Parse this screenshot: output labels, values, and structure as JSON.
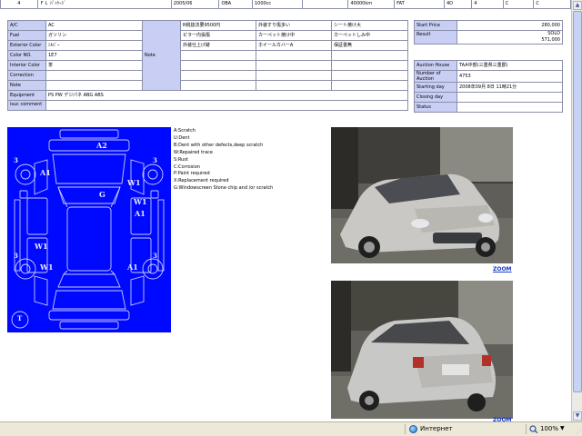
{
  "top_row": [
    "4",
    "ＦＬ ﾊﾟｯｹｰｼﾞ",
    "2005/06",
    "OBA",
    "1000cc",
    "40000km",
    "FAT",
    "4D",
    "4",
    "C",
    "C"
  ],
  "specs": {
    "ac_label": "A/C",
    "ac_value": "AC",
    "fuel_label": "Fuel",
    "fuel_value": "ガソリン",
    "color_label": "Exterior Color",
    "color_value": "ｼﾙﾊﾞｰ",
    "colorno_label": "Color NO.",
    "colorno_value": "1E7",
    "interior_label": "Interior Color",
    "interior_value": "茶",
    "correction_label": "Correction",
    "note_label": "Note",
    "equipment_label": "Equipment",
    "equipment_value": "PS PW デジパネ ABG ABS",
    "isuc_label": "isuc comment",
    "note_col_label": "Note"
  },
  "notes": [
    [
      "R税抜法要9500円",
      "外装すり傷多い",
      "シート焼け大"
    ],
    [
      "ピラー内張傷",
      "カーペット焼け中",
      "カーペットしみ中"
    ],
    [
      "外装仕上げ跡",
      "ホイールカバーA",
      "保証書無"
    ]
  ],
  "price": {
    "start_label": "Start Price",
    "start_value": "280,000",
    "result_label": "Result",
    "result_status": "SOLD",
    "result_value": "571,000"
  },
  "auction": {
    "house_label": "Auction House",
    "house_value": "TAA中部(三重県三重郡)",
    "number_label": "Number of Auction",
    "number_value": "4753",
    "starting_label": "Starting day",
    "starting_value": "2008年09月 8日 11時21分",
    "closing_label": "Closing day",
    "status_label": "Status"
  },
  "diagram_marks": {
    "a2": "A2",
    "three_l": "3",
    "three_r": "3",
    "a1_l": "A1",
    "w1_r": "W1",
    "g": "G",
    "w1_r2": "W1",
    "a1_r": "A1",
    "w1_l": "W1",
    "a1_bl": "A1",
    "a1_br": "A1",
    "w1_bl": "W1",
    "three_bl": "3",
    "three_br": "3",
    "t": "T"
  },
  "legend": [
    "A:Scratch",
    "U:Dent",
    "B:Dent with other defects,deep scratch",
    "W:Repaired trace",
    "S:Rust",
    "C:Corrosion",
    "P:Paint required",
    "X:Replacement required",
    "G:Windowscreen Stone chip and /or scratch"
  ],
  "zoom_label": "ZOOM",
  "statusbar": {
    "zone": "Интернет",
    "zoom": "100%"
  },
  "colors": {
    "diagram_bg": "#0009ff",
    "label_bg": "#c9cff4",
    "link": "#1a3cc8"
  }
}
